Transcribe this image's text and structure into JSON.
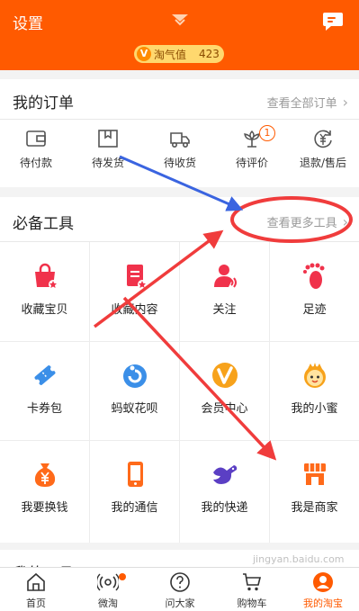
{
  "header": {
    "title": "设置",
    "taoqizhi_label": "淘气值",
    "taoqizhi_value": "423",
    "v_badge": "V",
    "bg_color": "#ff5a00"
  },
  "orders": {
    "title": "我的订单",
    "view_all": "查看全部订单",
    "items": [
      {
        "label": "待付款",
        "icon": "wallet-icon"
      },
      {
        "label": "待发货",
        "icon": "package-icon"
      },
      {
        "label": "待收货",
        "icon": "truck-icon"
      },
      {
        "label": "待评价",
        "icon": "flower-icon",
        "badge": "1"
      },
      {
        "label": "退款/售后",
        "icon": "refund-icon"
      }
    ]
  },
  "tools": {
    "title": "必备工具",
    "view_more": "查看更多工具",
    "items": [
      {
        "label": "收藏宝贝",
        "icon": "favorite-bag-icon"
      },
      {
        "label": "收藏内容",
        "icon": "favorite-content-icon"
      },
      {
        "label": "关注",
        "icon": "follow-icon"
      },
      {
        "label": "足迹",
        "icon": "footprint-icon"
      },
      {
        "label": "卡券包",
        "icon": "coupon-icon"
      },
      {
        "label": "蚂蚁花呗",
        "icon": "huabei-icon"
      },
      {
        "label": "会员中心",
        "icon": "member-center-icon"
      },
      {
        "label": "我的小蜜",
        "icon": "assistant-icon"
      },
      {
        "label": "我要换钱",
        "icon": "money-bag-icon"
      },
      {
        "label": "我的通信",
        "icon": "phone-icon"
      },
      {
        "label": "我的快递",
        "icon": "bird-icon"
      },
      {
        "label": "我是商家",
        "icon": "shop-icon"
      }
    ]
  },
  "next_section": {
    "title": "我的工具"
  },
  "tabbar": {
    "items": [
      {
        "label": "首页",
        "icon": "home-icon"
      },
      {
        "label": "微淘",
        "icon": "weitao-icon"
      },
      {
        "label": "问大家",
        "icon": "question-icon"
      },
      {
        "label": "购物车",
        "icon": "cart-icon"
      },
      {
        "label": "我的淘宝",
        "icon": "my-taobao-icon",
        "active": true
      }
    ]
  },
  "watermark": "jingyan.baidu.com",
  "colors": {
    "accent": "#ff5a00",
    "annotation_red": "#f03c3c",
    "annotation_blue": "#3a64e0"
  }
}
